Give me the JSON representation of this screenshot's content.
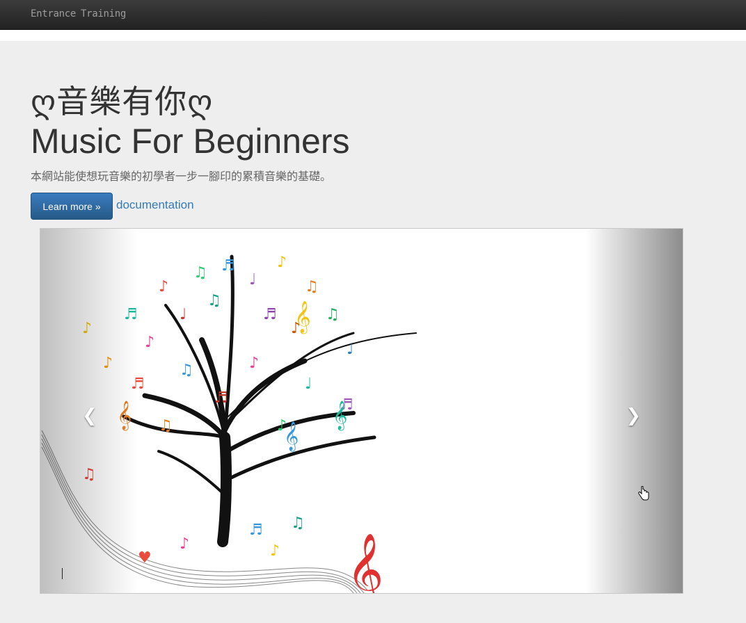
{
  "navbar": {
    "links": [
      "Entrance",
      "Training"
    ]
  },
  "hero": {
    "title_zh": "ღ音樂有你ღ",
    "title_en": "Music For Beginners",
    "tagline": "本網站能使想玩音樂的初學者一步一腳印的累積音樂的基礎。",
    "learn_more_label": "Learn more »",
    "documentation_label": "documentation"
  },
  "carousel": {
    "prev_icon": "chevron-left-icon",
    "next_icon": "chevron-right-icon",
    "slide_image": "music-notes-tree-illustration"
  },
  "colors": {
    "navbar_bg": "#222222",
    "jumbotron_bg": "#eeeeee",
    "primary": "#337ab7",
    "text": "#333333"
  }
}
